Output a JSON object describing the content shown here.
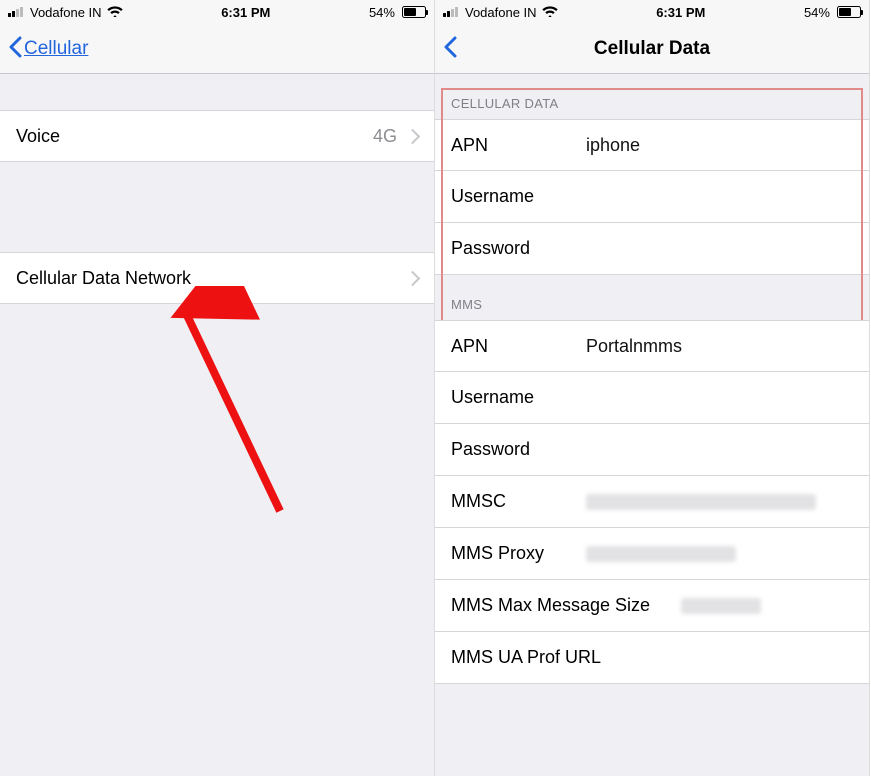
{
  "status": {
    "carrier": "Vodafone IN",
    "time": "6:31 PM",
    "battery_pct": "54%"
  },
  "left": {
    "back_label": "Cellular",
    "rows": {
      "voice": {
        "label": "Voice",
        "value": "4G"
      },
      "cdn": {
        "label": "Cellular Data Network"
      }
    }
  },
  "right": {
    "title": "Cellular Data",
    "sections": {
      "cellular_data": {
        "header": "CELLULAR DATA",
        "apn": {
          "label": "APN",
          "value": "iphone"
        },
        "username": {
          "label": "Username",
          "value": ""
        },
        "password": {
          "label": "Password",
          "value": ""
        }
      },
      "mms": {
        "header": "MMS",
        "apn": {
          "label": "APN",
          "value": "Portalnmms"
        },
        "username": {
          "label": "Username",
          "value": ""
        },
        "password": {
          "label": "Password",
          "value": ""
        },
        "mmsc": {
          "label": "MMSC"
        },
        "proxy": {
          "label": "MMS Proxy"
        },
        "max_size": {
          "label": "MMS Max Message Size"
        },
        "ua_prof": {
          "label": "MMS UA Prof URL"
        }
      }
    }
  }
}
